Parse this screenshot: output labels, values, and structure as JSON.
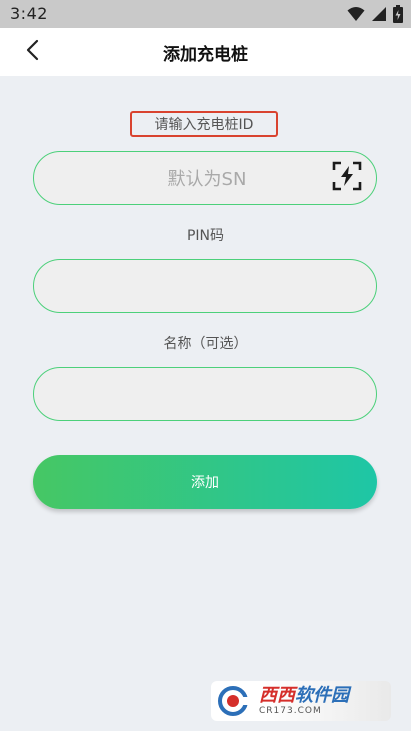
{
  "status_bar": {
    "time": "3:42"
  },
  "app_bar": {
    "title": "添加充电桩"
  },
  "form": {
    "id_label": "请输入充电桩ID",
    "id_input_placeholder": "默认为SN",
    "id_input_value": "",
    "pin_label": "PIN码",
    "pin_input_value": "",
    "name_label": "名称（可选）",
    "name_input_value": "",
    "submit_label": "添加"
  },
  "watermark": {
    "brand_red": "西西",
    "brand_blue": "软件园",
    "domain": "CR173.COM"
  },
  "colors": {
    "accent_green": "#46c764",
    "accent_teal": "#1ec6a6",
    "field_border": "#4cd07a",
    "highlight_box": "#d9432f"
  }
}
